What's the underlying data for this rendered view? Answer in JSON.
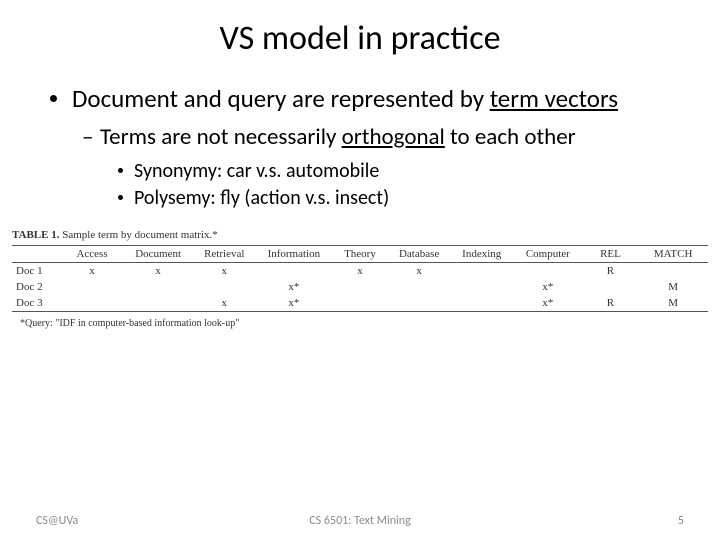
{
  "title": "VS model in practice",
  "bullet1_pre": "Document and query are represented by ",
  "bullet1_u": "term vectors",
  "bullet2_pre": "Terms are not necessarily ",
  "bullet2_u": "orthogonal",
  "bullet2_post": " to each other",
  "bullet3a": "Synonymy: car v.s. automobile",
  "bullet3b": "Polysemy: fly (action v.s. insect)",
  "table": {
    "caption_label": "TABLE 1.",
    "caption_text": "Sample term by document matrix.*",
    "headers": [
      "",
      "Access",
      "Document",
      "Retrieval",
      "Information",
      "Theory",
      "Database",
      "Indexing",
      "Computer",
      "REL",
      "MATCH"
    ],
    "rows": [
      {
        "label": "Doc 1",
        "cells": [
          "x",
          "x",
          "x",
          "",
          "x",
          "x",
          "",
          "",
          "R",
          ""
        ]
      },
      {
        "label": "Doc 2",
        "cells": [
          "",
          "",
          "",
          "x*",
          "",
          "",
          "",
          "x*",
          "",
          "M"
        ]
      },
      {
        "label": "Doc 3",
        "cells": [
          "",
          "",
          "x",
          "x*",
          "",
          "",
          "",
          "x*",
          "R",
          "M"
        ]
      }
    ],
    "footnote": "*Query: \"IDF in computer-based information look-up\""
  },
  "footer": {
    "left": "CS@UVa",
    "center": "CS 6501: Text Mining",
    "right": "5"
  },
  "chart_data": {
    "type": "table",
    "title": "Sample term by document matrix",
    "columns": [
      "Access",
      "Document",
      "Retrieval",
      "Information",
      "Theory",
      "Database",
      "Indexing",
      "Computer",
      "REL",
      "MATCH"
    ],
    "rows": {
      "Doc 1": [
        "x",
        "x",
        "x",
        "",
        "x",
        "x",
        "",
        "",
        "R",
        ""
      ],
      "Doc 2": [
        "",
        "",
        "",
        "x*",
        "",
        "",
        "",
        "x*",
        "",
        "M"
      ],
      "Doc 3": [
        "",
        "",
        "x",
        "x*",
        "",
        "",
        "",
        "x*",
        "R",
        "M"
      ]
    },
    "query": "IDF in computer-based information look-up"
  }
}
